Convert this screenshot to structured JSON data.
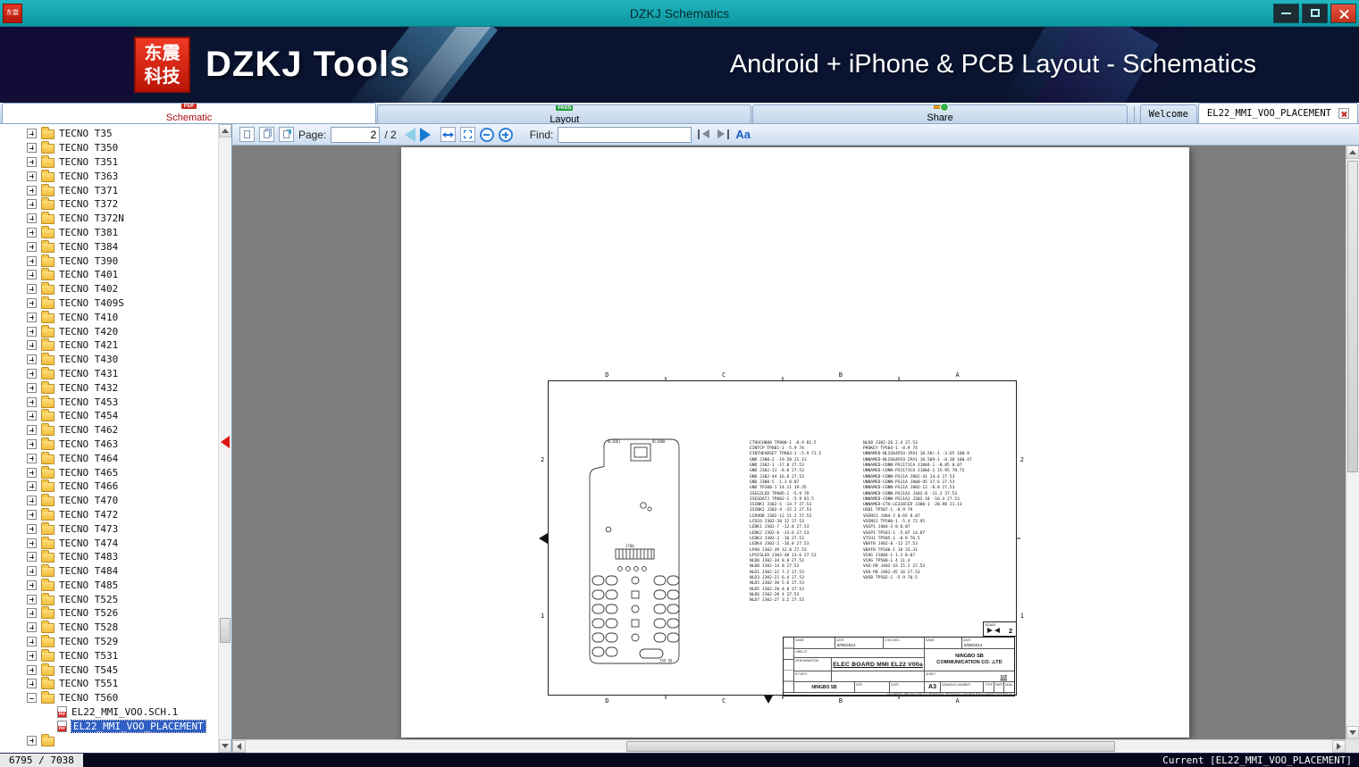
{
  "window": {
    "title": "DZKJ Schematics"
  },
  "banner": {
    "logo_line1": "东震",
    "logo_line2": "科技",
    "app_name": "DZKJ Tools",
    "tagline": "Android + iPhone & PCB Layout - Schematics"
  },
  "icons": {
    "pdf": "PDF",
    "pads": "PADS",
    "font": "Aa"
  },
  "tabs": {
    "main": [
      {
        "label": "Schematic"
      },
      {
        "label": "Layout"
      },
      {
        "label": "Share"
      }
    ],
    "docs": [
      {
        "label": "Welcome"
      },
      {
        "label": "EL22_MMI_VOO_PLACEMENT"
      }
    ]
  },
  "toolbar": {
    "page_label": "Page:",
    "page_value": "2",
    "page_total": "/ 2",
    "find_label": "Find:",
    "find_value": ""
  },
  "tree": {
    "folders": [
      "TECNO T35",
      "TECNO T350",
      "TECNO T351",
      "TECNO T363",
      "TECNO T371",
      "TECNO T372",
      "TECNO T372N",
      "TECNO T381",
      "TECNO T384",
      "TECNO T390",
      "TECNO T401",
      "TECNO T402",
      "TECNO T409S",
      "TECNO T410",
      "TECNO T420",
      "TECNO T421",
      "TECNO T430",
      "TECNO T431",
      "TECNO T432",
      "TECNO T453",
      "TECNO T454",
      "TECNO T462",
      "TECNO T463",
      "TECNO T464",
      "TECNO T465",
      "TECNO T466",
      "TECNO T470",
      "TECNO T472",
      "TECNO T473",
      "TECNO T474",
      "TECNO T483",
      "TECNO T484",
      "TECNO T485",
      "TECNO T525",
      "TECNO T526",
      "TECNO T528",
      "TECNO T529",
      "TECNO T531",
      "TECNO T545",
      "TECNO T551"
    ],
    "expanded": "TECNO T560",
    "children": [
      {
        "label": "EL22_MMI_VOO.SCH.1"
      },
      {
        "label": "EL22_MMI_VOO_PLACEMENT"
      }
    ]
  },
  "doc": {
    "frame": {
      "cols": [
        "D",
        "C",
        "B",
        "A"
      ],
      "rows": [
        "2",
        "1"
      ]
    },
    "pcb_labels": {
      "shield_left": "BL1001",
      "shield_right": "BL1000",
      "connector": "J700",
      "bottom": "J99 99"
    },
    "placement_col1": [
      "CTOUCH800 TP800-1 -8.9 81.5",
      "EINTCP TP801-1 -5.9 74",
      "EINTHEADSET TP803-1 -5.9 71.5",
      "GND J300-2 -19.58 21.13",
      "GND J302-1 -17.8 27.53",
      "GND J302-11 -8.8 27.53",
      "GND J302-44 16.8 27.53",
      "GND J300-5 -1.3 8.07",
      "GND TP100-1 14.11 19.35",
      "ISESZLED TP805-1 -5.9 79",
      "ISESDATJ TP802-1 -5.9 81.5",
      "ISINK1 J302-5 -14.7 27.53",
      "ISINK2 J302-4 -15.2 27.53",
      "LCDVDD J302-12 11.2 27.53",
      "LCDIO J302-38 12 27.53",
      "LEDK1 J302-7 -12.8 27.53",
      "LEDK2 J302-6 -13.6 27.53",
      "LEDK3 J302-3 -16 27.53",
      "LEDK4 J302-2 -16.8 27.53",
      "LPA8 J302-39 12.8 27.53",
      "LPCESLED J302-40 13.6 27.53",
      "NLD0 J302-34 8.8 27.53",
      "NLD0 J302-14 8 27.53",
      "NLD1 J302-22 7.2 27.53",
      "NLD3 J302-21 6.4 27.53",
      "NLD5 J302-30 5.6 27.53",
      "NLD5 J302-28 4.8 27.53",
      "NLD6 J302-20 4 27.53",
      "NLD7 J302-27 3.2 27.53"
    ],
    "placement_col2": [
      "NLD8 J302-26 2.4 27.53",
      "PROKEY TP504-1 -8.9 74",
      "UNNAMED-NLIO64PIO-1PA1 18.58(-1 -3.65 100.9",
      "UNNAMED-NLIO64PIO-2PA1 18.509-1 -8.38 100.47",
      "UNNAMED-CONN-PS1171CA J1004-1 -8.85 8.07",
      "UNNAMED-CONN-PS1171CA J1004-1 15.95 70.72",
      "UNNAMED-CONN-PS11A J802-41 14.4 27.53",
      "UNNAMED-CONN-PS11A J800-45 17.6 27.53",
      "UNNAMED-CONN-PS11A J802-12 -8.8 27.53",
      "UNNAMED-CONN-PS11A3 J402-8 -11.2 27.53",
      "UNNAMED-CONN-PS11A1 J302-18 -10.4 27.53",
      "UNNAMED-ETH-LE316CED J300-1 -20.98 21.13",
      "USB1 TP507-1 -8.9 79",
      "VSENS1 J404-2 0.65 8.07",
      "VSENS1 TP500-1 -5.4 72.95",
      "VSGP1 J404-3 0 8.07",
      "VSGP1 TP501-1 -5.07 14.07",
      "VTCH1 TP505-1 -8.9 76.5",
      "VBATB J402-8 -12 27.53",
      "VBATB TP100-1 18 33.31",
      "VCHG J1004-1 1.3 8.07",
      "VCHG TP500-1 4 11.4",
      "VSD-PB J402-43 15.2 27.53",
      "VSD-PB J402-45 16 27.53",
      "VUSB TP502-1 -5.9 70.5"
    ],
    "title_block": {
      "name_label": "NAME",
      "date_label": "DATE",
      "date_value": "8/08/2014",
      "checked_label": "CHECKED",
      "libelle_label": "LIBELLE",
      "denomination_label": "DENOMINATION",
      "denomination_value": "ELEC BOARD MMI EL22  V00a",
      "rfpn_label": "R.F&P.N.",
      "author": "NINGBO SB",
      "company_line1": "NINGBO SB",
      "company_line2": "COMMUNICATION CO. ,LTD",
      "sheet_label": "SHEET",
      "sheet_value": "1/2",
      "size_value": "A3",
      "drawing_label": "DRAWING NUMBER",
      "type_label": "TYPE",
      "part_label": "PART",
      "num_label": "NUM",
      "ver_label": "VER",
      "date2_label": "DATE",
      "scale_label": "SCALE",
      "scale_value": "2",
      "footer": "DOCUMENT AND ALL RIGHTS RESERVED, REPRODUCTION AND DISCLOSURE PROHIBITED"
    }
  },
  "status": {
    "left": "6795 / 7038",
    "right": "Current [EL22_MMI_VOO_PLACEMENT]"
  }
}
